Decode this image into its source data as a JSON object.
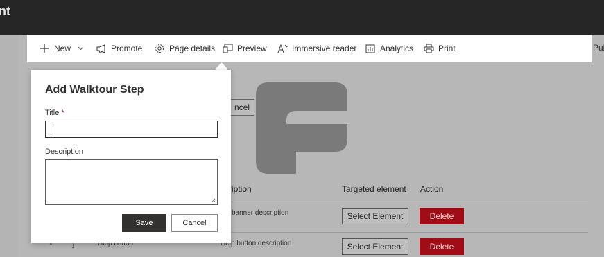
{
  "topbar": {
    "title_fragment": "nt"
  },
  "commandbar": {
    "items": [
      {
        "label": "New",
        "icon": "plus-icon"
      },
      {
        "label": "Promote",
        "icon": "megaphone-icon"
      },
      {
        "label": "Page details",
        "icon": "gear-icon"
      },
      {
        "label": "Preview",
        "icon": "preview-icon"
      },
      {
        "label": "Immersive reader",
        "icon": "immersive-reader-icon"
      },
      {
        "label": "Analytics",
        "icon": "analytics-icon"
      },
      {
        "label": "Print",
        "icon": "print-icon"
      }
    ],
    "publish_fragment": "Pub"
  },
  "background": {
    "cancel_fragment": "ncel",
    "table": {
      "headers": [
        "scription",
        "Targeted element",
        "Action"
      ],
      "rows": [
        {
          "title": "",
          "description": "banner description",
          "select_label": "Select Element",
          "delete_label": "Delete"
        },
        {
          "title": "Help button",
          "description": "Help button description",
          "select_label": "Select Element",
          "delete_label": "Delete"
        }
      ]
    }
  },
  "dialog": {
    "title": "Add Walktour Step",
    "title_label": "Title",
    "required_mark": "*",
    "title_value": "",
    "description_label": "Description",
    "description_value": "",
    "save_label": "Save",
    "cancel_label": "Cancel"
  },
  "colors": {
    "delete": "#a4262c",
    "primary_button": "#323130",
    "overlay": "#a9a9a9"
  }
}
